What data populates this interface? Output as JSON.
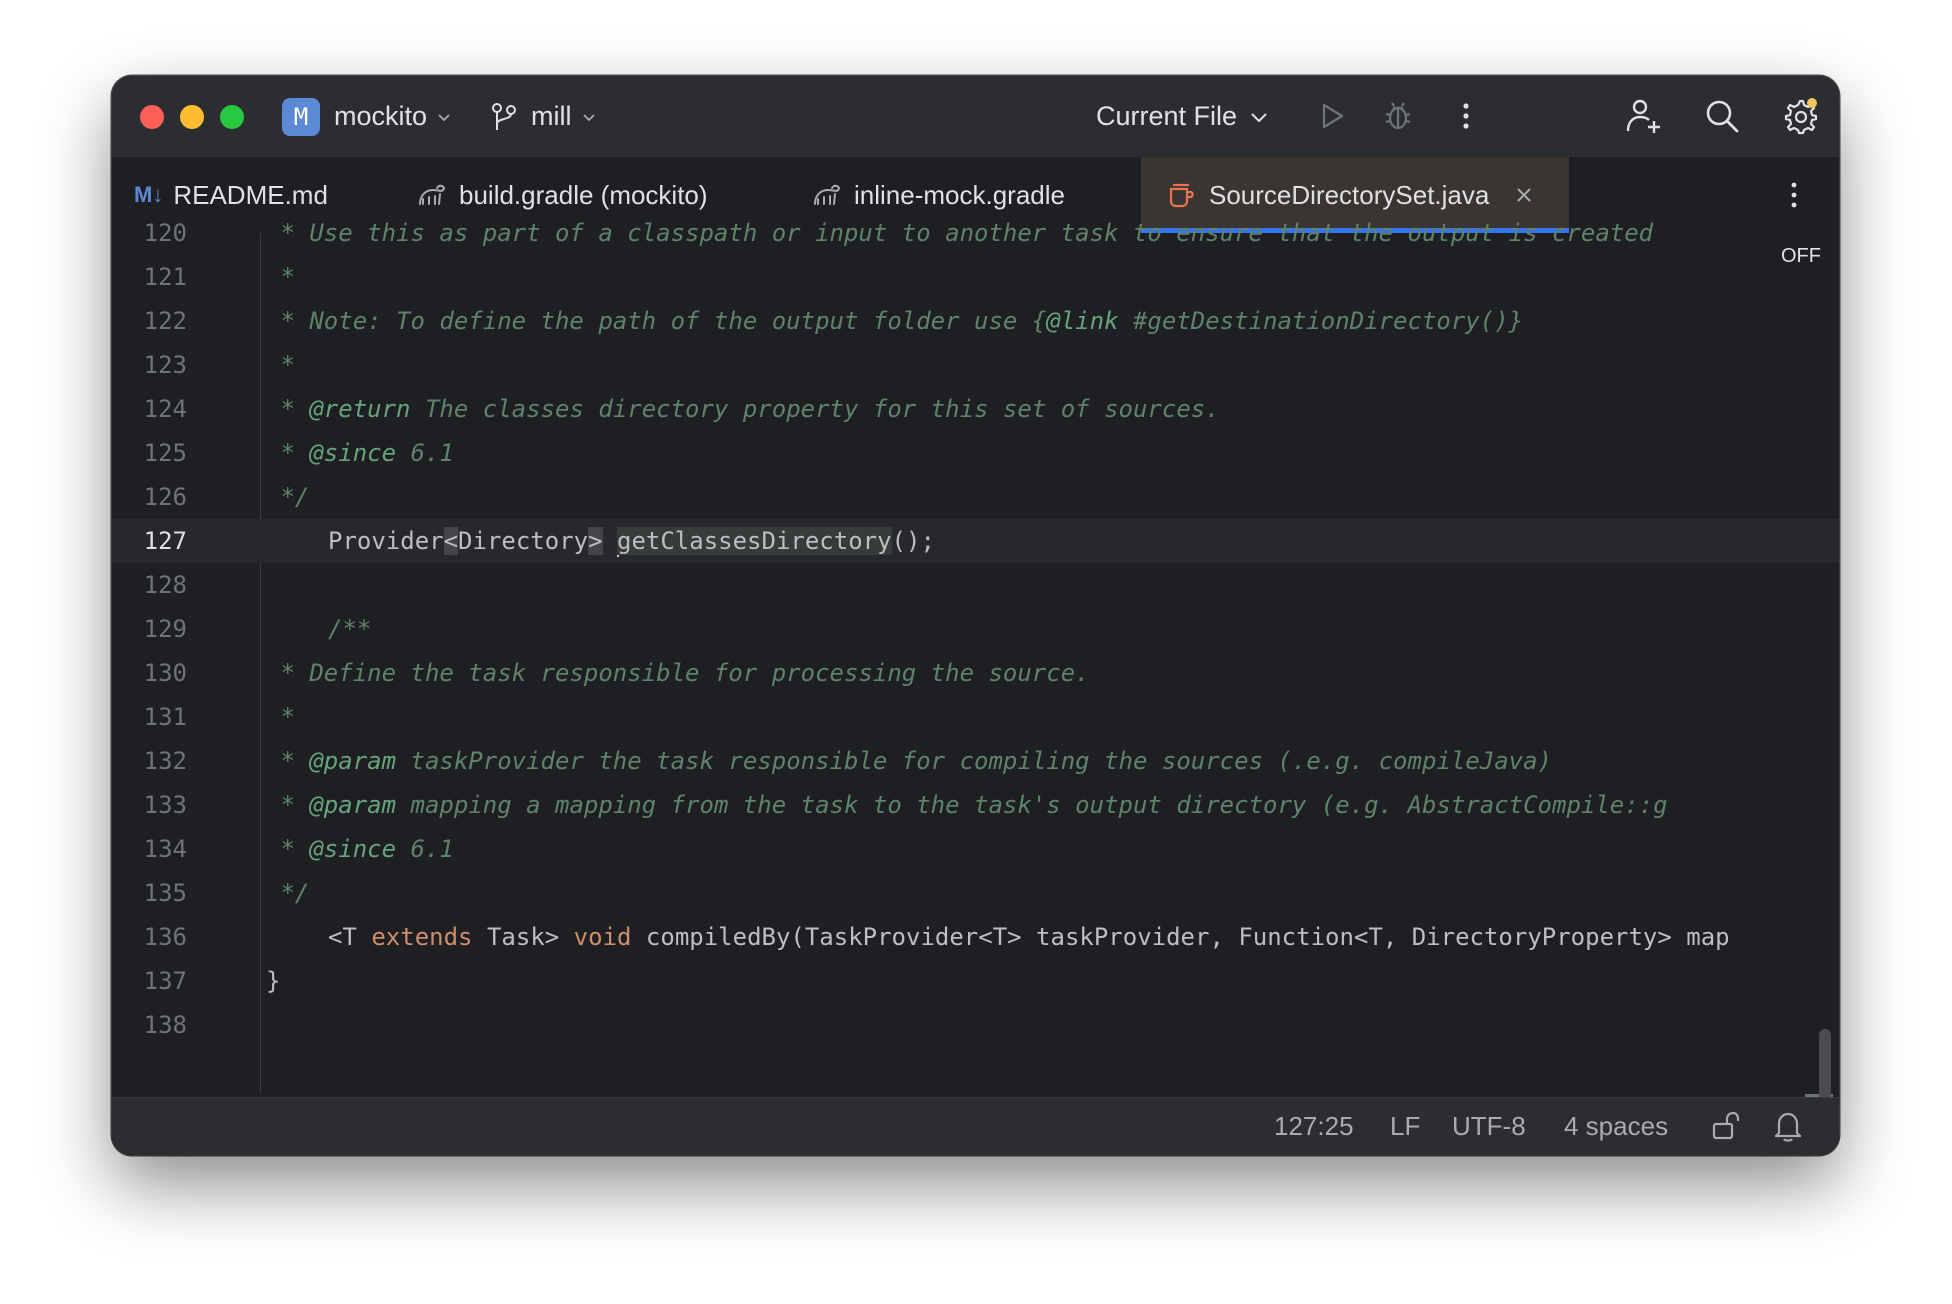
{
  "titlebar": {
    "project_badge": "M",
    "project_name": "mockito",
    "branch_name": "mill",
    "run_config": "Current File"
  },
  "tabs": [
    {
      "icon_text": "M↓",
      "label": "README.md"
    },
    {
      "label": "build.gradle (mockito)"
    },
    {
      "label": "inline-mock.gradle"
    },
    {
      "label": "SourceDirectorySet.java",
      "active": true
    }
  ],
  "editor": {
    "inspection_label": "OFF",
    "current_line": "127",
    "lines": [
      {
        "num": "120",
        "text": " * Use this as part of a classpath or input to another task to ensure that the output is created"
      },
      {
        "num": "121",
        "text": " *"
      },
      {
        "num": "122",
        "text": " * Note: To define the path of the output folder use {@link #getDestinationDirectory()}"
      },
      {
        "num": "123",
        "text": " *"
      },
      {
        "num": "124",
        "text": " * @return The classes directory property for this set of sources."
      },
      {
        "num": "125",
        "text": " * @since 6.1"
      },
      {
        "num": "126",
        "text": " */"
      },
      {
        "num": "127",
        "text": "Provider<Directory> getClassesDirectory();"
      },
      {
        "num": "128",
        "text": ""
      },
      {
        "num": "129",
        "text": "/**"
      },
      {
        "num": "130",
        "text": " * Define the task responsible for processing the source."
      },
      {
        "num": "131",
        "text": " *"
      },
      {
        "num": "132",
        "text": " * @param taskProvider the task responsible for compiling the sources (.e.g. compileJava)"
      },
      {
        "num": "133",
        "text": " * @param mapping a mapping from the task to the task's output directory (e.g. AbstractCompile::g"
      },
      {
        "num": "134",
        "text": " * @since 6.1"
      },
      {
        "num": "135",
        "text": " */"
      },
      {
        "num": "136",
        "text": "<T extends Task> void compiledBy(TaskProvider<T> taskProvider, Function<T, DirectoryProperty> map"
      },
      {
        "num": "137",
        "text": "}"
      },
      {
        "num": "138",
        "text": ""
      }
    ]
  },
  "statusbar": {
    "position": "127:25",
    "line_separator": "LF",
    "encoding": "UTF-8",
    "indent": "4 spaces"
  },
  "colors": {
    "accent": "#3574f0",
    "comment": "#5f826b",
    "doc_tag": "#67a37c",
    "keyword": "#cf8e6d",
    "text": "#bcbec4"
  }
}
